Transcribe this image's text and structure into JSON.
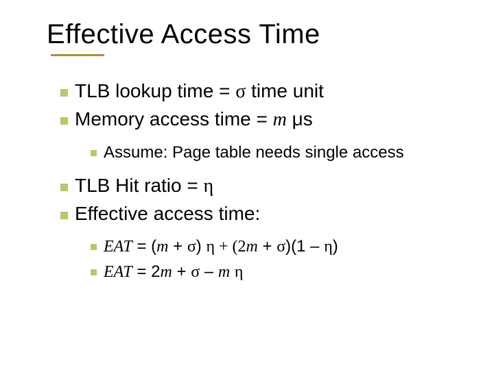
{
  "title": "Effective Access Time",
  "bullets": {
    "b1_pre": "TLB lookup time = ",
    "b1_sym": "σ",
    "b1_post": " time unit",
    "b2_pre": "Memory access time = ",
    "b2_m": "m",
    "b2_post": " μs",
    "b3": "Assume: Page table needs single access",
    "b4_pre": "TLB Hit ratio = ",
    "b4_sym": "η",
    "b5": "Effective access time:",
    "b6_eat": "EAT",
    "b6_eq": " = (",
    "b6_m1": "m",
    "b6_mid1": " + ",
    "b6_sig1": "σ",
    "b6_mid2": ") ",
    "b6_eta1": "η",
    "b6_mid3": " + (2",
    "b6_m2": "m",
    "b6_mid4": " + ",
    "b6_sig2": "σ",
    "b6_mid5": ")(1 – ",
    "b6_eta2": "η",
    "b6_end": ")",
    "b7_eat": "EAT",
    "b7_eq": " = 2",
    "b7_m": "m",
    "b7_mid1": " + ",
    "b7_sig": "σ",
    "b7_mid2": " – ",
    "b7_m2": "m",
    "b7_sp": " ",
    "b7_eta": "η"
  }
}
